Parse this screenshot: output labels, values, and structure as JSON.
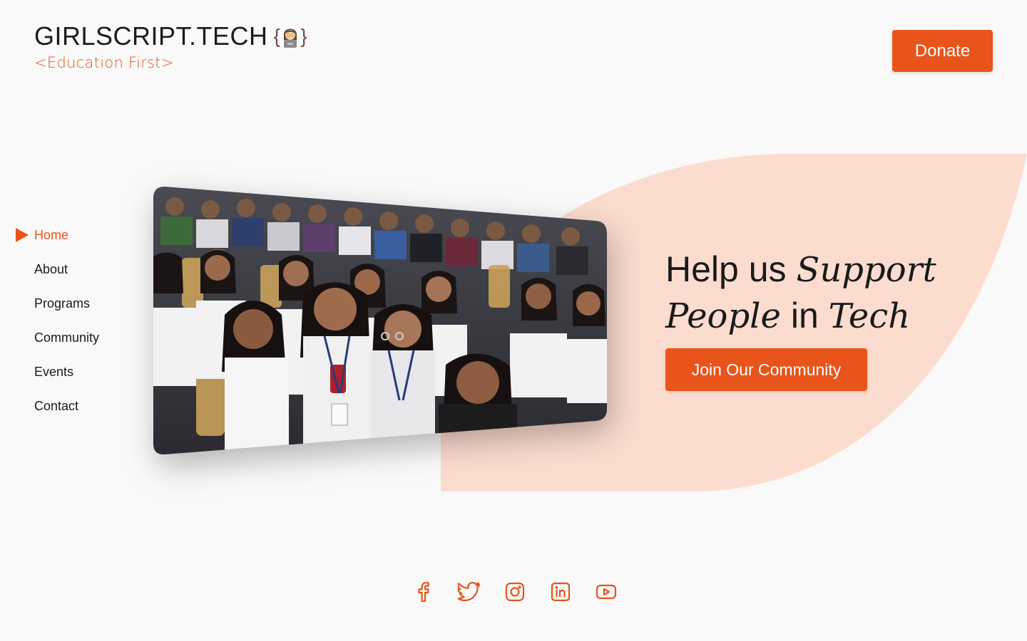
{
  "brand": {
    "name": "GIRLSCRIPT.TECH",
    "tagline": "<Education First>",
    "logo_icon": "girl-coder-icon"
  },
  "header": {
    "donate_label": "Donate"
  },
  "nav": {
    "items": [
      {
        "label": "Home",
        "active": true
      },
      {
        "label": "About",
        "active": false
      },
      {
        "label": "Programs",
        "active": false
      },
      {
        "label": "Community",
        "active": false
      },
      {
        "label": "Events",
        "active": false
      },
      {
        "label": "Contact",
        "active": false
      }
    ]
  },
  "hero": {
    "headline": {
      "part1": "Help us ",
      "part2": "Support",
      "part3": "People",
      "part4": " in ",
      "part5": "Tech"
    },
    "cta_label": "Join Our Community",
    "image_icon": "students-audience-photo"
  },
  "social": {
    "icons": [
      "facebook-icon",
      "twitter-icon",
      "instagram-icon",
      "linkedin-icon",
      "youtube-icon"
    ]
  },
  "colors": {
    "accent": "#e8541a",
    "leaf": "#fddcd0",
    "background": "#f9f9f9",
    "text": "#1a1a1a"
  }
}
